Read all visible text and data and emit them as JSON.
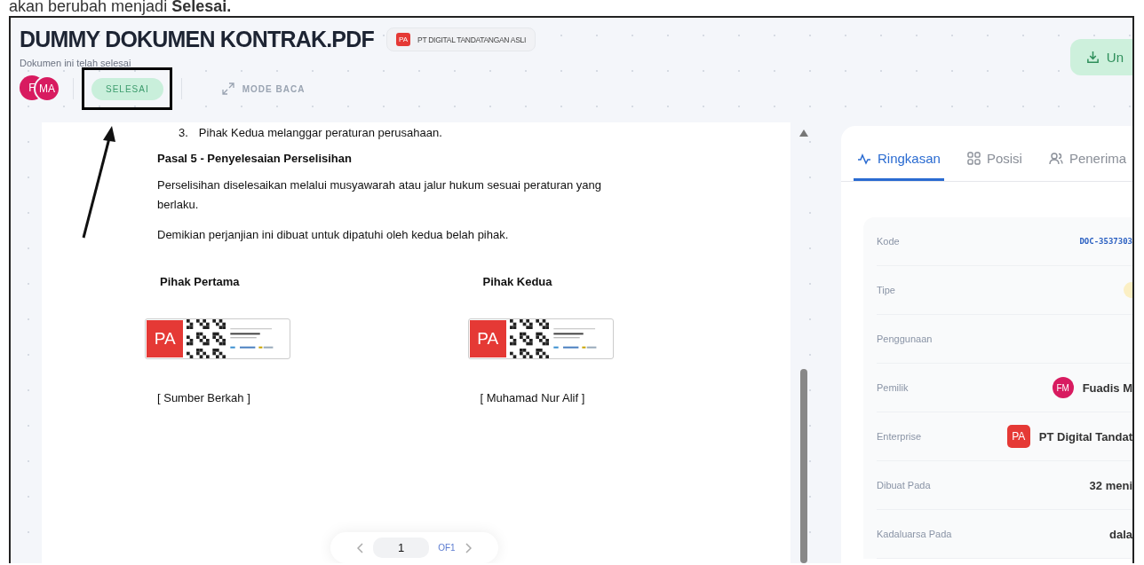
{
  "caption": "akan berubah menjadi **Selesai.**",
  "header": {
    "title": "DUMMY DOKUMEN KONTRAK.PDF",
    "org": {
      "logo": "PA",
      "name": "PT DIGITAL TANDATANGAN ASLI"
    },
    "subtitle": "Dokumen ini telah selesai",
    "avatars": [
      "F",
      "MA"
    ],
    "status": "SELESAI",
    "mode": "MODE BACA",
    "download": "Un"
  },
  "document": {
    "list_item": {
      "number": "3.",
      "text": "Pihak Kedua melanggar peraturan perusahaan."
    },
    "heading": "Pasal 5 - Penyelesaian Perselisihan",
    "paragraphs": [
      "Perselisihan diselesaikan melalui musyawarah atau jalur hukum sesuai peraturan yang berlaku.",
      "Demikian perjanjian ini dibuat untuk dipatuhi oleh kedua belah pihak."
    ],
    "signatories": [
      {
        "role": "Pihak Pertama",
        "stamp_logo": "PA",
        "name": "[ Sumber Berkah ]"
      },
      {
        "role": "Pihak Kedua",
        "stamp_logo": "PA",
        "name": "[ Muhamad Nur Alif ]"
      }
    ],
    "pagination": {
      "page": "1",
      "of": "OF1"
    }
  },
  "panel": {
    "tabs": [
      {
        "label": "Ringkasan",
        "selected": true
      },
      {
        "label": "Posisi",
        "selected": false
      },
      {
        "label": "Penerima",
        "selected": false
      }
    ],
    "details": [
      {
        "label": "Kode",
        "kind": "code",
        "value": "DOC-3537303"
      },
      {
        "label": "Tipe",
        "kind": "pill"
      },
      {
        "label": "Penggunaan",
        "kind": "blank"
      },
      {
        "label": "Pemilik",
        "kind": "avatar",
        "badge": "FM",
        "value": "Fuadis M"
      },
      {
        "label": "Enterprise",
        "kind": "logo",
        "badge": "PA",
        "value": "PT Digital Tandat"
      },
      {
        "label": "Dibuat Pada",
        "kind": "text",
        "value": "32 meni"
      },
      {
        "label": "Kadaluarsa Pada",
        "kind": "text",
        "value": "dala"
      }
    ]
  }
}
